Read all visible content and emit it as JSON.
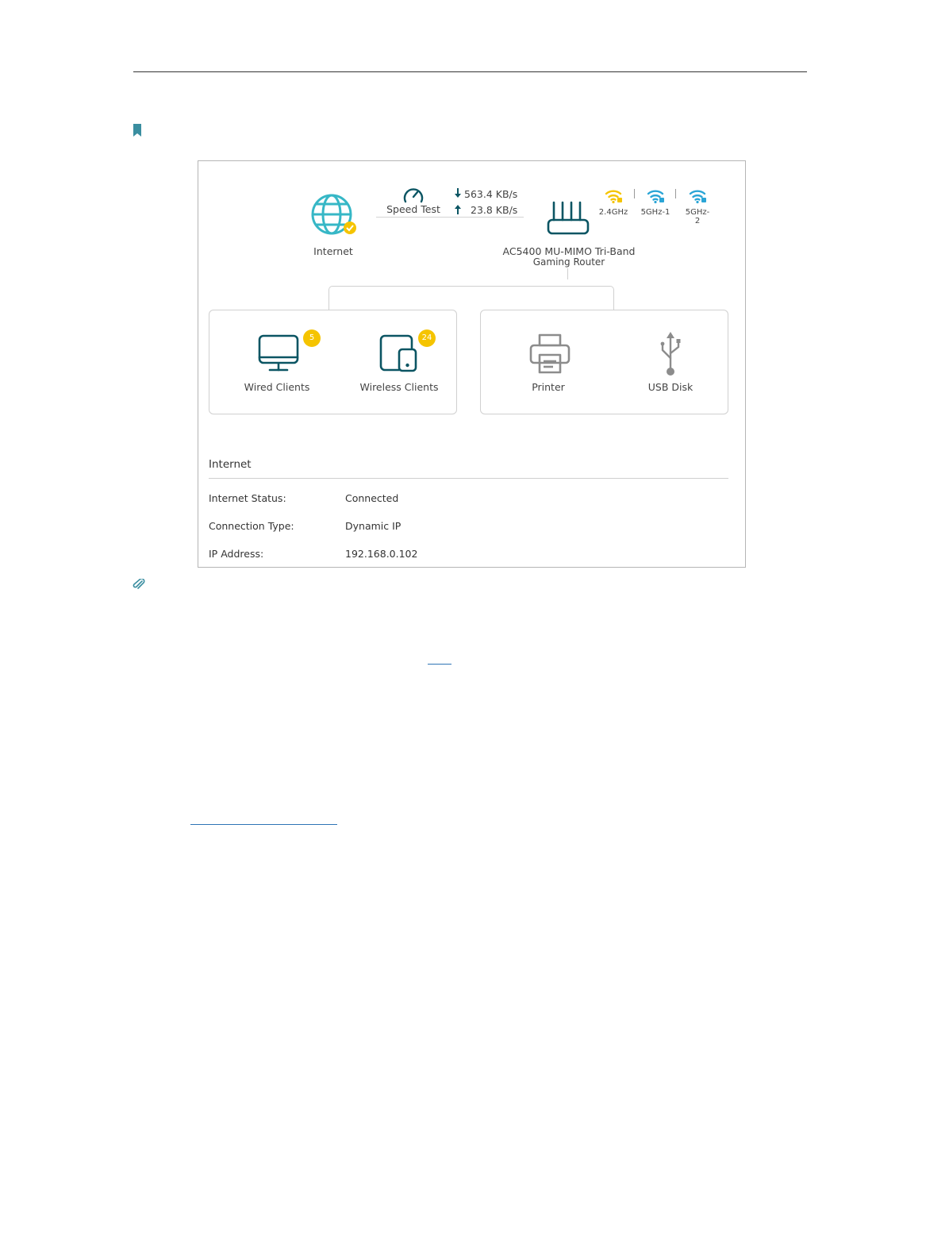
{
  "colors": {
    "teal_dark": "#0b5563",
    "teal_light": "#36b7c6",
    "accent_blue": "#2aa5d6",
    "yellow": "#f5c400",
    "gray_icon": "#8c8c8c"
  },
  "topology": {
    "internet_label": "Internet",
    "speed_test_label": "Speed Test",
    "download_speed": "563.4 KB/s",
    "upload_speed": "23.8 KB/s",
    "router_name_line1": "AC5400 MU-MIMO Tri-Band",
    "router_name_line2": "Gaming Router",
    "bands": [
      {
        "label": "2.4GHz",
        "color": "#f5c400"
      },
      {
        "label": "5GHz-1",
        "color": "#2aa5d6"
      },
      {
        "label": "5GHz-2",
        "color": "#2aa5d6"
      }
    ]
  },
  "clients": {
    "wired_label": "Wired Clients",
    "wired_count": "5",
    "wireless_label": "Wireless Clients",
    "wireless_count": "24",
    "printer_label": "Printer",
    "usb_label": "USB Disk"
  },
  "internet_section": {
    "title": "Internet",
    "rows": [
      {
        "label": "Internet Status:",
        "value": "Connected"
      },
      {
        "label": "Connection Type:",
        "value": "Dynamic IP"
      },
      {
        "label": "IP Address:",
        "value": "192.168.0.102"
      }
    ]
  }
}
